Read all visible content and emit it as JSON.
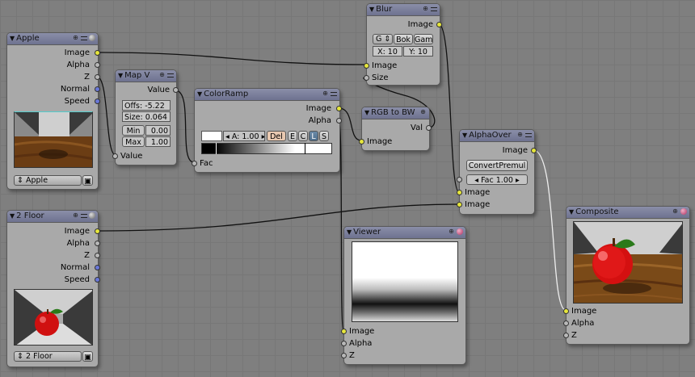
{
  "colors": {
    "background": "#7f7f7f",
    "node_body": "#a9a9a9",
    "node_header": "#7a7e9c",
    "socket_image": "#e6e63c",
    "socket_value": "#b8b8b8",
    "socket_vector": "#6a78d8"
  },
  "apple": {
    "title": "Apple",
    "outputs": [
      "Image",
      "Alpha",
      "Z",
      "Normal",
      "Speed"
    ],
    "scene_selector": "Apple"
  },
  "floor": {
    "title": "2 Floor",
    "outputs": [
      "Image",
      "Alpha",
      "Z",
      "Normal",
      "Speed"
    ],
    "scene_selector": "2 Floor"
  },
  "mapv": {
    "title": "Map V",
    "output": "Value",
    "offs": "Offs: -5.22",
    "size": "Size: 0.064",
    "min_label": "Min",
    "min_value": "0.00",
    "max_label": "Max",
    "max_value": "1.00",
    "input": "Value"
  },
  "colorramp": {
    "title": "ColorRamp",
    "outputs": [
      "Image",
      "Alpha"
    ],
    "alpha_field": "A: 1.00",
    "del": "Del",
    "e": "E",
    "c": "C",
    "l": "L",
    "s": "S",
    "input": "Fac"
  },
  "blur": {
    "title": "Blur",
    "output": "Image",
    "filter": "G",
    "bok": "Bok",
    "gam": "Gam",
    "x": "X: 10",
    "y": "Y: 10",
    "inputs": [
      "Image",
      "Size"
    ]
  },
  "rgbbw": {
    "title": "RGB to BW",
    "output": "Val",
    "input": "Image"
  },
  "alphaover": {
    "title": "AlphaOver",
    "output": "Image",
    "convert": "ConvertPremul",
    "fac": "Fac 1.00",
    "inputs": [
      "Image",
      "Image"
    ]
  },
  "viewer": {
    "title": "Viewer",
    "inputs": [
      "Image",
      "Alpha",
      "Z"
    ]
  },
  "composite": {
    "title": "Composite",
    "inputs": [
      "Image",
      "Alpha",
      "Z"
    ]
  }
}
